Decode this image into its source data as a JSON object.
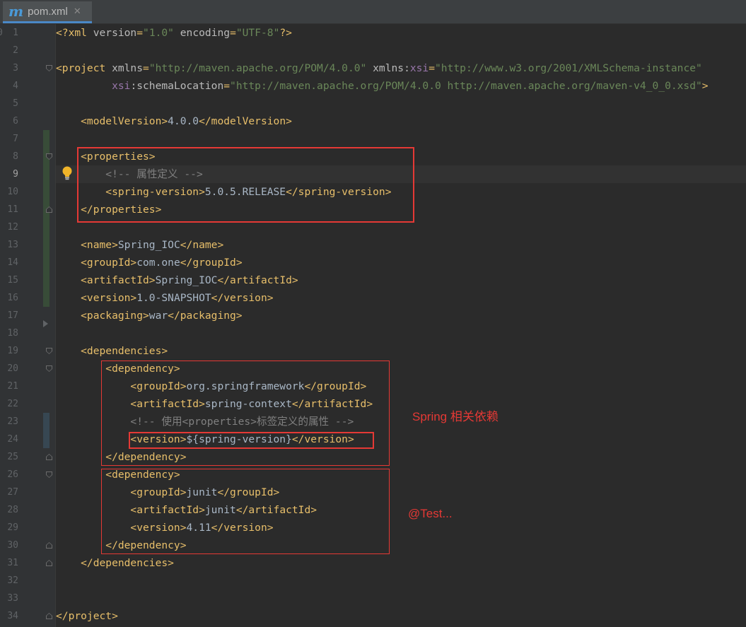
{
  "tab": {
    "icon": "maven-m-icon",
    "icon_glyph": "m",
    "label": "pom.xml",
    "close_glyph": "✕"
  },
  "gutter": {
    "partial_line_number": "0",
    "current_line": 9
  },
  "lines": [
    {
      "n": "1",
      "tokens": [
        [
          "tag",
          "<?xml "
        ],
        [
          "attr",
          "version"
        ],
        [
          "tag",
          "="
        ],
        [
          "val",
          "\"1.0\""
        ],
        [
          "tag",
          " "
        ],
        [
          "attr",
          "encoding"
        ],
        [
          "tag",
          "="
        ],
        [
          "val",
          "\"UTF-8\""
        ],
        [
          "tag",
          "?>"
        ]
      ]
    },
    {
      "n": "2",
      "tokens": []
    },
    {
      "n": "3",
      "tokens": [
        [
          "tag",
          "<project "
        ],
        [
          "attr",
          "xmlns"
        ],
        [
          "tag",
          "="
        ],
        [
          "val",
          "\"http://maven.apache.org/POM/4.0.0\""
        ],
        [
          "tag",
          " "
        ],
        [
          "attr",
          "xmlns:"
        ],
        [
          "ns",
          "xsi"
        ],
        [
          "tag",
          "="
        ],
        [
          "val",
          "\"http://www.w3.org/2001/XMLSchema-instance\""
        ]
      ]
    },
    {
      "n": "4",
      "tokens": [
        [
          "tag",
          "         "
        ],
        [
          "ns",
          "xsi"
        ],
        [
          "attr",
          ":schemaLocation"
        ],
        [
          "tag",
          "="
        ],
        [
          "val",
          "\"http://maven.apache.org/POM/4.0.0 http://maven.apache.org/maven-v4_0_0.xsd\""
        ],
        [
          "tag",
          ">"
        ]
      ]
    },
    {
      "n": "5",
      "tokens": []
    },
    {
      "n": "6",
      "tokens": [
        [
          "tag",
          "    <modelVersion>"
        ],
        [
          "txt",
          "4.0.0"
        ],
        [
          "tag",
          "</modelVersion>"
        ]
      ]
    },
    {
      "n": "7",
      "tokens": []
    },
    {
      "n": "8",
      "tokens": [
        [
          "tag",
          "    <properties>"
        ]
      ]
    },
    {
      "n": "9",
      "tokens": [
        [
          "cmt",
          "        <!-- 属性定义 -->"
        ]
      ]
    },
    {
      "n": "10",
      "tokens": [
        [
          "tag",
          "        <spring-version>"
        ],
        [
          "txt",
          "5.0.5.RELEASE"
        ],
        [
          "tag",
          "</spring-version>"
        ]
      ]
    },
    {
      "n": "11",
      "tokens": [
        [
          "tag",
          "    </properties>"
        ]
      ]
    },
    {
      "n": "12",
      "tokens": []
    },
    {
      "n": "13",
      "tokens": [
        [
          "tag",
          "    <name>"
        ],
        [
          "txt",
          "Spring_IOC"
        ],
        [
          "tag",
          "</name>"
        ]
      ]
    },
    {
      "n": "14",
      "tokens": [
        [
          "tag",
          "    <groupId>"
        ],
        [
          "txt",
          "com.one"
        ],
        [
          "tag",
          "</groupId>"
        ]
      ]
    },
    {
      "n": "15",
      "tokens": [
        [
          "tag",
          "    <artifactId>"
        ],
        [
          "txt",
          "Spring_IOC"
        ],
        [
          "tag",
          "</artifactId>"
        ]
      ]
    },
    {
      "n": "16",
      "tokens": [
        [
          "tag",
          "    <version>"
        ],
        [
          "txt",
          "1.0-SNAPSHOT"
        ],
        [
          "tag",
          "</version>"
        ]
      ]
    },
    {
      "n": "17",
      "tokens": [
        [
          "tag",
          "    <packaging>"
        ],
        [
          "txt",
          "war"
        ],
        [
          "tag",
          "</packaging>"
        ]
      ]
    },
    {
      "n": "18",
      "tokens": []
    },
    {
      "n": "19",
      "tokens": [
        [
          "tag",
          "    <dependencies>"
        ]
      ]
    },
    {
      "n": "20",
      "tokens": [
        [
          "tag",
          "        <dependency>"
        ]
      ]
    },
    {
      "n": "21",
      "tokens": [
        [
          "tag",
          "            <groupId>"
        ],
        [
          "txt",
          "org.springframework"
        ],
        [
          "tag",
          "</groupId>"
        ]
      ]
    },
    {
      "n": "22",
      "tokens": [
        [
          "tag",
          "            <artifactId>"
        ],
        [
          "txt",
          "spring-context"
        ],
        [
          "tag",
          "</artifactId>"
        ]
      ]
    },
    {
      "n": "23",
      "tokens": [
        [
          "cmt",
          "            <!-- 使用<properties>标签定义的属性 -->"
        ]
      ]
    },
    {
      "n": "24",
      "tokens": [
        [
          "tag",
          "            <version>"
        ],
        [
          "txt",
          "${spring-version}"
        ],
        [
          "tag",
          "</version>"
        ]
      ]
    },
    {
      "n": "25",
      "tokens": [
        [
          "tag",
          "        </dependency>"
        ]
      ]
    },
    {
      "n": "26",
      "tokens": [
        [
          "tag",
          "        <dependency>"
        ]
      ]
    },
    {
      "n": "27",
      "tokens": [
        [
          "tag",
          "            <groupId>"
        ],
        [
          "txt",
          "junit"
        ],
        [
          "tag",
          "</groupId>"
        ]
      ]
    },
    {
      "n": "28",
      "tokens": [
        [
          "tag",
          "            <artifactId>"
        ],
        [
          "txt",
          "junit"
        ],
        [
          "tag",
          "</artifactId>"
        ]
      ]
    },
    {
      "n": "29",
      "tokens": [
        [
          "tag",
          "            <version>"
        ],
        [
          "txt",
          "4.11"
        ],
        [
          "tag",
          "</version>"
        ]
      ]
    },
    {
      "n": "30",
      "tokens": [
        [
          "tag",
          "        </dependency>"
        ]
      ]
    },
    {
      "n": "31",
      "tokens": [
        [
          "tag",
          "    </dependencies>"
        ]
      ]
    },
    {
      "n": "32",
      "tokens": []
    },
    {
      "n": "33",
      "tokens": []
    },
    {
      "n": "34",
      "tokens": [
        [
          "tag",
          "</project>"
        ]
      ]
    }
  ],
  "fold_markers": [
    {
      "line": 3,
      "kind": "open"
    },
    {
      "line": 8,
      "kind": "open"
    },
    {
      "line": 11,
      "kind": "close"
    },
    {
      "line": 19,
      "kind": "open"
    },
    {
      "line": 20,
      "kind": "open"
    },
    {
      "line": 25,
      "kind": "close"
    },
    {
      "line": 26,
      "kind": "open"
    },
    {
      "line": 30,
      "kind": "close"
    },
    {
      "line": 31,
      "kind": "close"
    },
    {
      "line": 34,
      "kind": "close"
    }
  ],
  "annotations": {
    "spring_note": "Spring 相关依赖",
    "test_note": "@Test..."
  },
  "colors": {
    "editor_bg": "#2b2b2b",
    "tag": "#e8bf6a",
    "attribute": "#bababa",
    "namespace": "#9876aa",
    "string": "#6a8759",
    "comment": "#808080",
    "text": "#a9b7c6",
    "annotation_red": "#e53935",
    "bulb": "#f0b429"
  }
}
